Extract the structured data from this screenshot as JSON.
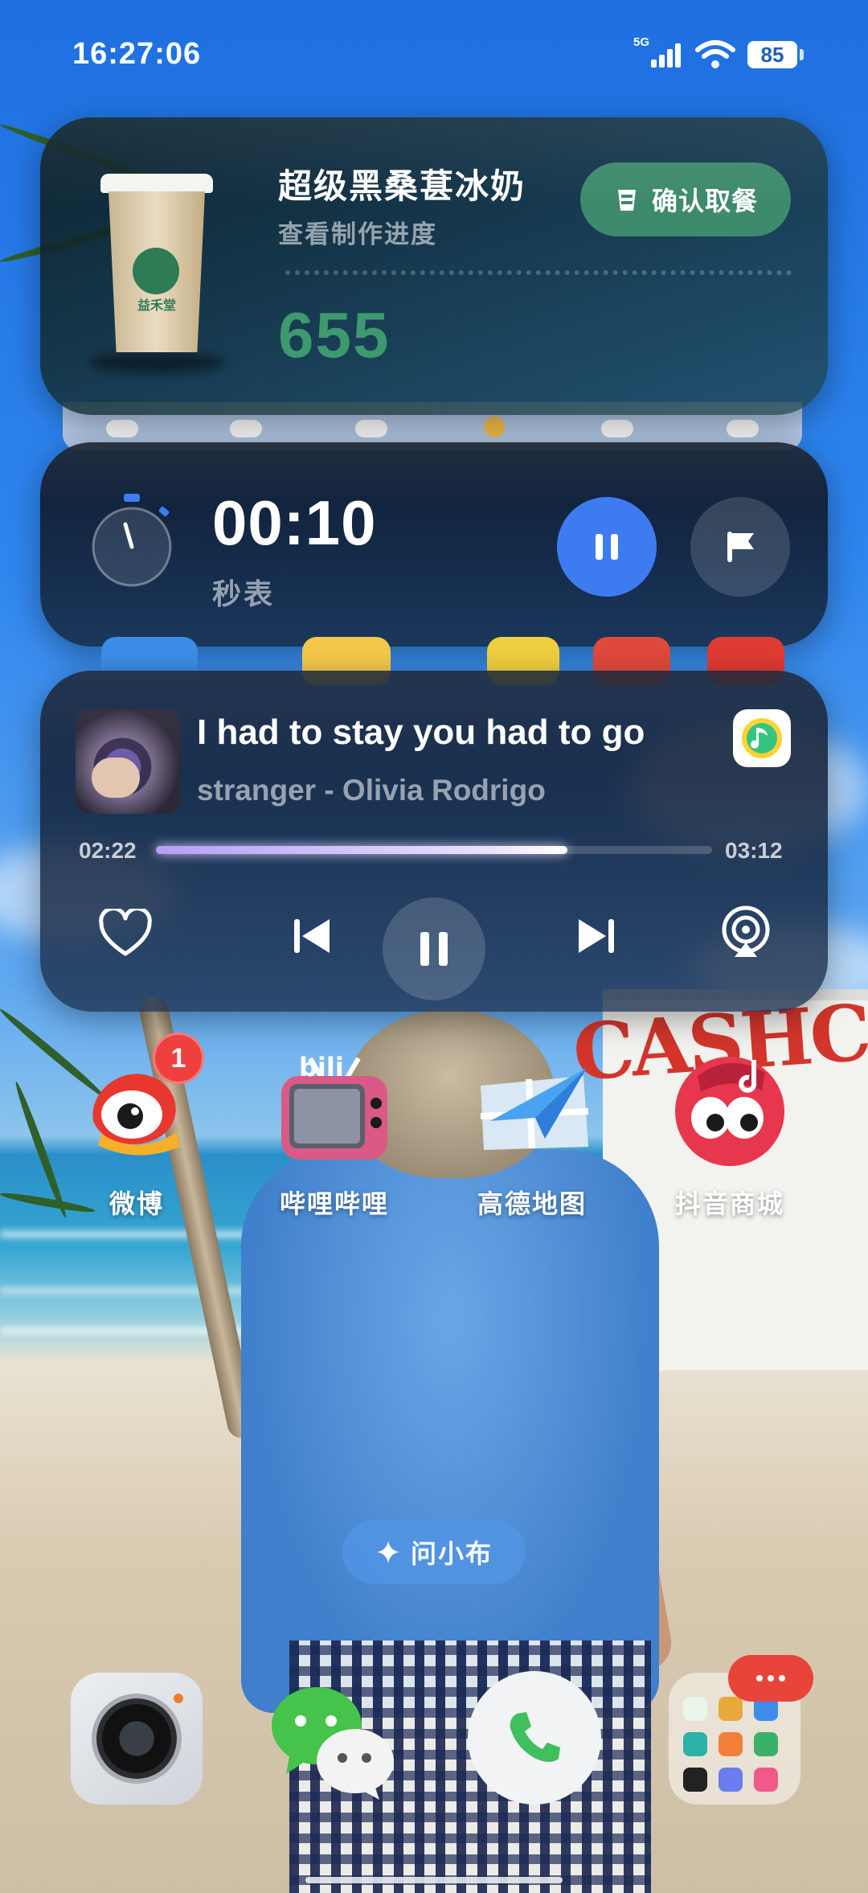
{
  "status_bar": {
    "time": "16:27:06",
    "network": "5G",
    "battery": "85"
  },
  "order_card": {
    "product": "超级黑桑葚冰奶",
    "subtitle": "查看制作进度",
    "pickup_code": "655",
    "button_label": "确认取餐",
    "brand_text": "益禾堂",
    "accent_color": "#3e8a6c"
  },
  "stopwatch": {
    "time": "00:10",
    "label": "秒表",
    "accent_color": "#3d7cf0"
  },
  "music": {
    "title": "I had to stay you had to go",
    "artist": "stranger - Olivia Rodrigo",
    "position": "02:22",
    "duration": "03:12",
    "progress_fraction": 0.74,
    "app_icon": "qq-music-icon"
  },
  "apps": [
    {
      "name": "微博",
      "icon": "weibo-icon",
      "badge": "1"
    },
    {
      "name": "哔哩哔哩",
      "icon": "bilibili-icon"
    },
    {
      "name": "高德地图",
      "icon": "amap-icon"
    },
    {
      "name": "抖音商城",
      "icon": "douyin-mall-icon"
    }
  ],
  "assistant": {
    "label": "问小布",
    "icon": "sparkle-icon"
  },
  "dock": [
    "camera-icon",
    "wechat-icon",
    "phone-icon",
    "app-folder"
  ],
  "wallpaper_text": "CASHC"
}
